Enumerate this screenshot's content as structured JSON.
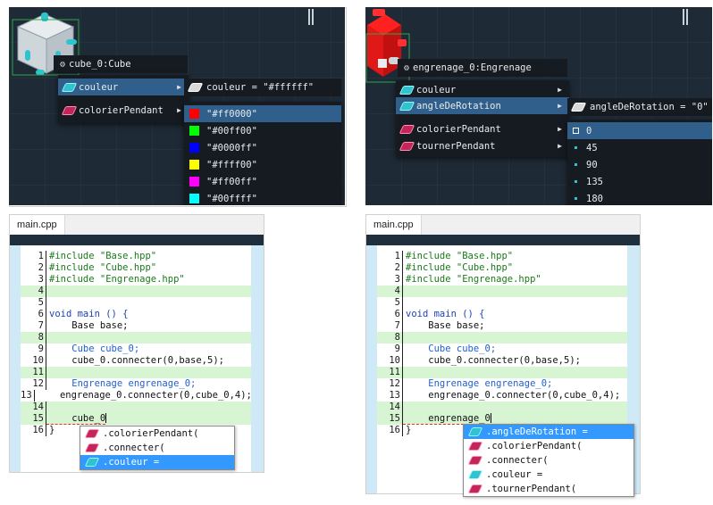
{
  "panel_top_left": {
    "header": "cube_0:Cube",
    "items": [
      {
        "label": "couleur",
        "icon": "cyan-gem-icon"
      },
      {
        "label": "colorierPendant",
        "icon": "magenta-gem-icon"
      }
    ],
    "value_header": "couleur = \"#ffffff\"",
    "colors": [
      {
        "label": "\"#ff0000\"",
        "hex": "#ff0000"
      },
      {
        "label": "\"#00ff00\"",
        "hex": "#00ff00"
      },
      {
        "label": "\"#0000ff\"",
        "hex": "#0000ff"
      },
      {
        "label": "\"#ffff00\"",
        "hex": "#ffff00"
      },
      {
        "label": "\"#ff00ff\"",
        "hex": "#ff00ff"
      },
      {
        "label": "\"#00ffff\"",
        "hex": "#00ffff"
      }
    ]
  },
  "panel_top_right": {
    "header": "engrenage_0:Engrenage",
    "items": [
      {
        "label": "couleur",
        "icon": "cyan-gem-icon"
      },
      {
        "label": "angleDeRotation",
        "icon": "cyan-gem-icon"
      },
      {
        "label": "colorierPendant",
        "icon": "magenta-gem-icon"
      },
      {
        "label": "tournerPendant",
        "icon": "magenta-gem-icon"
      }
    ],
    "value_header": "angleDeRotation = \"0\"",
    "values": [
      "0",
      "45",
      "90",
      "135",
      "180"
    ]
  },
  "editor_left": {
    "tab": "main.cpp",
    "lines": [
      {
        "n": "1",
        "t": "#include \"Base.hpp\""
      },
      {
        "n": "2",
        "t": "#include \"Cube.hpp\""
      },
      {
        "n": "3",
        "t": "#include \"Engrenage.hpp\""
      },
      {
        "n": "4",
        "t": ""
      },
      {
        "n": "5",
        "t": ""
      },
      {
        "n": "6",
        "t": "void main () {"
      },
      {
        "n": "7",
        "t": "    Base base;"
      },
      {
        "n": "8",
        "t": ""
      },
      {
        "n": "9",
        "t": "    Cube cube_0;"
      },
      {
        "n": "10",
        "t": "    cube_0.connecter(0,base,5);"
      },
      {
        "n": "11",
        "t": ""
      },
      {
        "n": "12",
        "t": "    Engrenage engrenage_0;"
      },
      {
        "n": "13",
        "t": "    engrenage_0.connecter(0,cube_0,4);"
      },
      {
        "n": "14",
        "t": ""
      },
      {
        "n": "15",
        "t": "    cube_0"
      },
      {
        "n": "16",
        "t": "}"
      }
    ],
    "completions": [
      {
        "label": ".colorierPendant(",
        "icon": "magenta-gem-icon"
      },
      {
        "label": ".connecter(",
        "icon": "magenta-gem-icon"
      },
      {
        "label": ".couleur =",
        "icon": "cyan-gem-icon"
      }
    ]
  },
  "editor_right": {
    "tab": "main.cpp",
    "lines": [
      {
        "n": "1",
        "t": "#include \"Base.hpp\""
      },
      {
        "n": "2",
        "t": "#include \"Cube.hpp\""
      },
      {
        "n": "3",
        "t": "#include \"Engrenage.hpp\""
      },
      {
        "n": "4",
        "t": ""
      },
      {
        "n": "5",
        "t": ""
      },
      {
        "n": "6",
        "t": "void main () {"
      },
      {
        "n": "7",
        "t": "    Base base;"
      },
      {
        "n": "8",
        "t": ""
      },
      {
        "n": "9",
        "t": "    Cube cube_0;"
      },
      {
        "n": "10",
        "t": "    cube_0.connecter(0,base,5);"
      },
      {
        "n": "11",
        "t": ""
      },
      {
        "n": "12",
        "t": "    Engrenage engrenage_0;"
      },
      {
        "n": "13",
        "t": "    engrenage_0.connecter(0,cube_0,4);"
      },
      {
        "n": "14",
        "t": ""
      },
      {
        "n": "15",
        "t": "    engrenage_0"
      },
      {
        "n": "16",
        "t": "}"
      }
    ],
    "completions": [
      {
        "label": ".angleDeRotation =",
        "icon": "cyan-gem-icon"
      },
      {
        "label": ".colorierPendant(",
        "icon": "magenta-gem-icon"
      },
      {
        "label": ".connecter(",
        "icon": "magenta-gem-icon"
      },
      {
        "label": ".couleur =",
        "icon": "cyan-gem-icon"
      },
      {
        "label": ".tournerPendant(",
        "icon": "magenta-gem-icon"
      }
    ]
  }
}
